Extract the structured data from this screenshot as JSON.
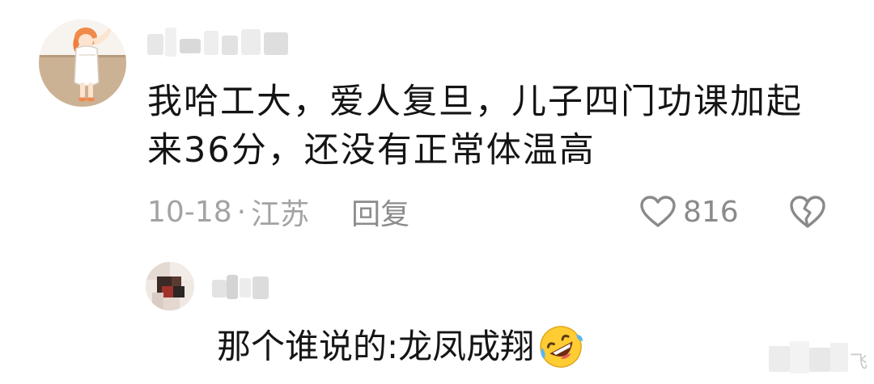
{
  "comment": {
    "avatar": "cartoon-girl-towel-avatar",
    "text": "我哈工大，爱人复旦，儿子四门功课加起来36分，还没有正常体温高",
    "date": "10-18",
    "separator": "·",
    "location": "江苏",
    "reply_label": "回复",
    "like_count": "816",
    "like_icon": "heart-outline-icon",
    "dislike_icon": "broken-heart-icon"
  },
  "reply": {
    "avatar": "pixelated-avatar",
    "text": "那个谁说的:龙凤成翔",
    "emoji": "rolling-on-floor-laughing-emoji"
  },
  "watermark": {
    "text": "飞"
  },
  "colors": {
    "text_primary": "#141414",
    "text_secondary": "#a3a3a3",
    "icon_gray": "#8a8a8a",
    "background": "#ffffff"
  }
}
